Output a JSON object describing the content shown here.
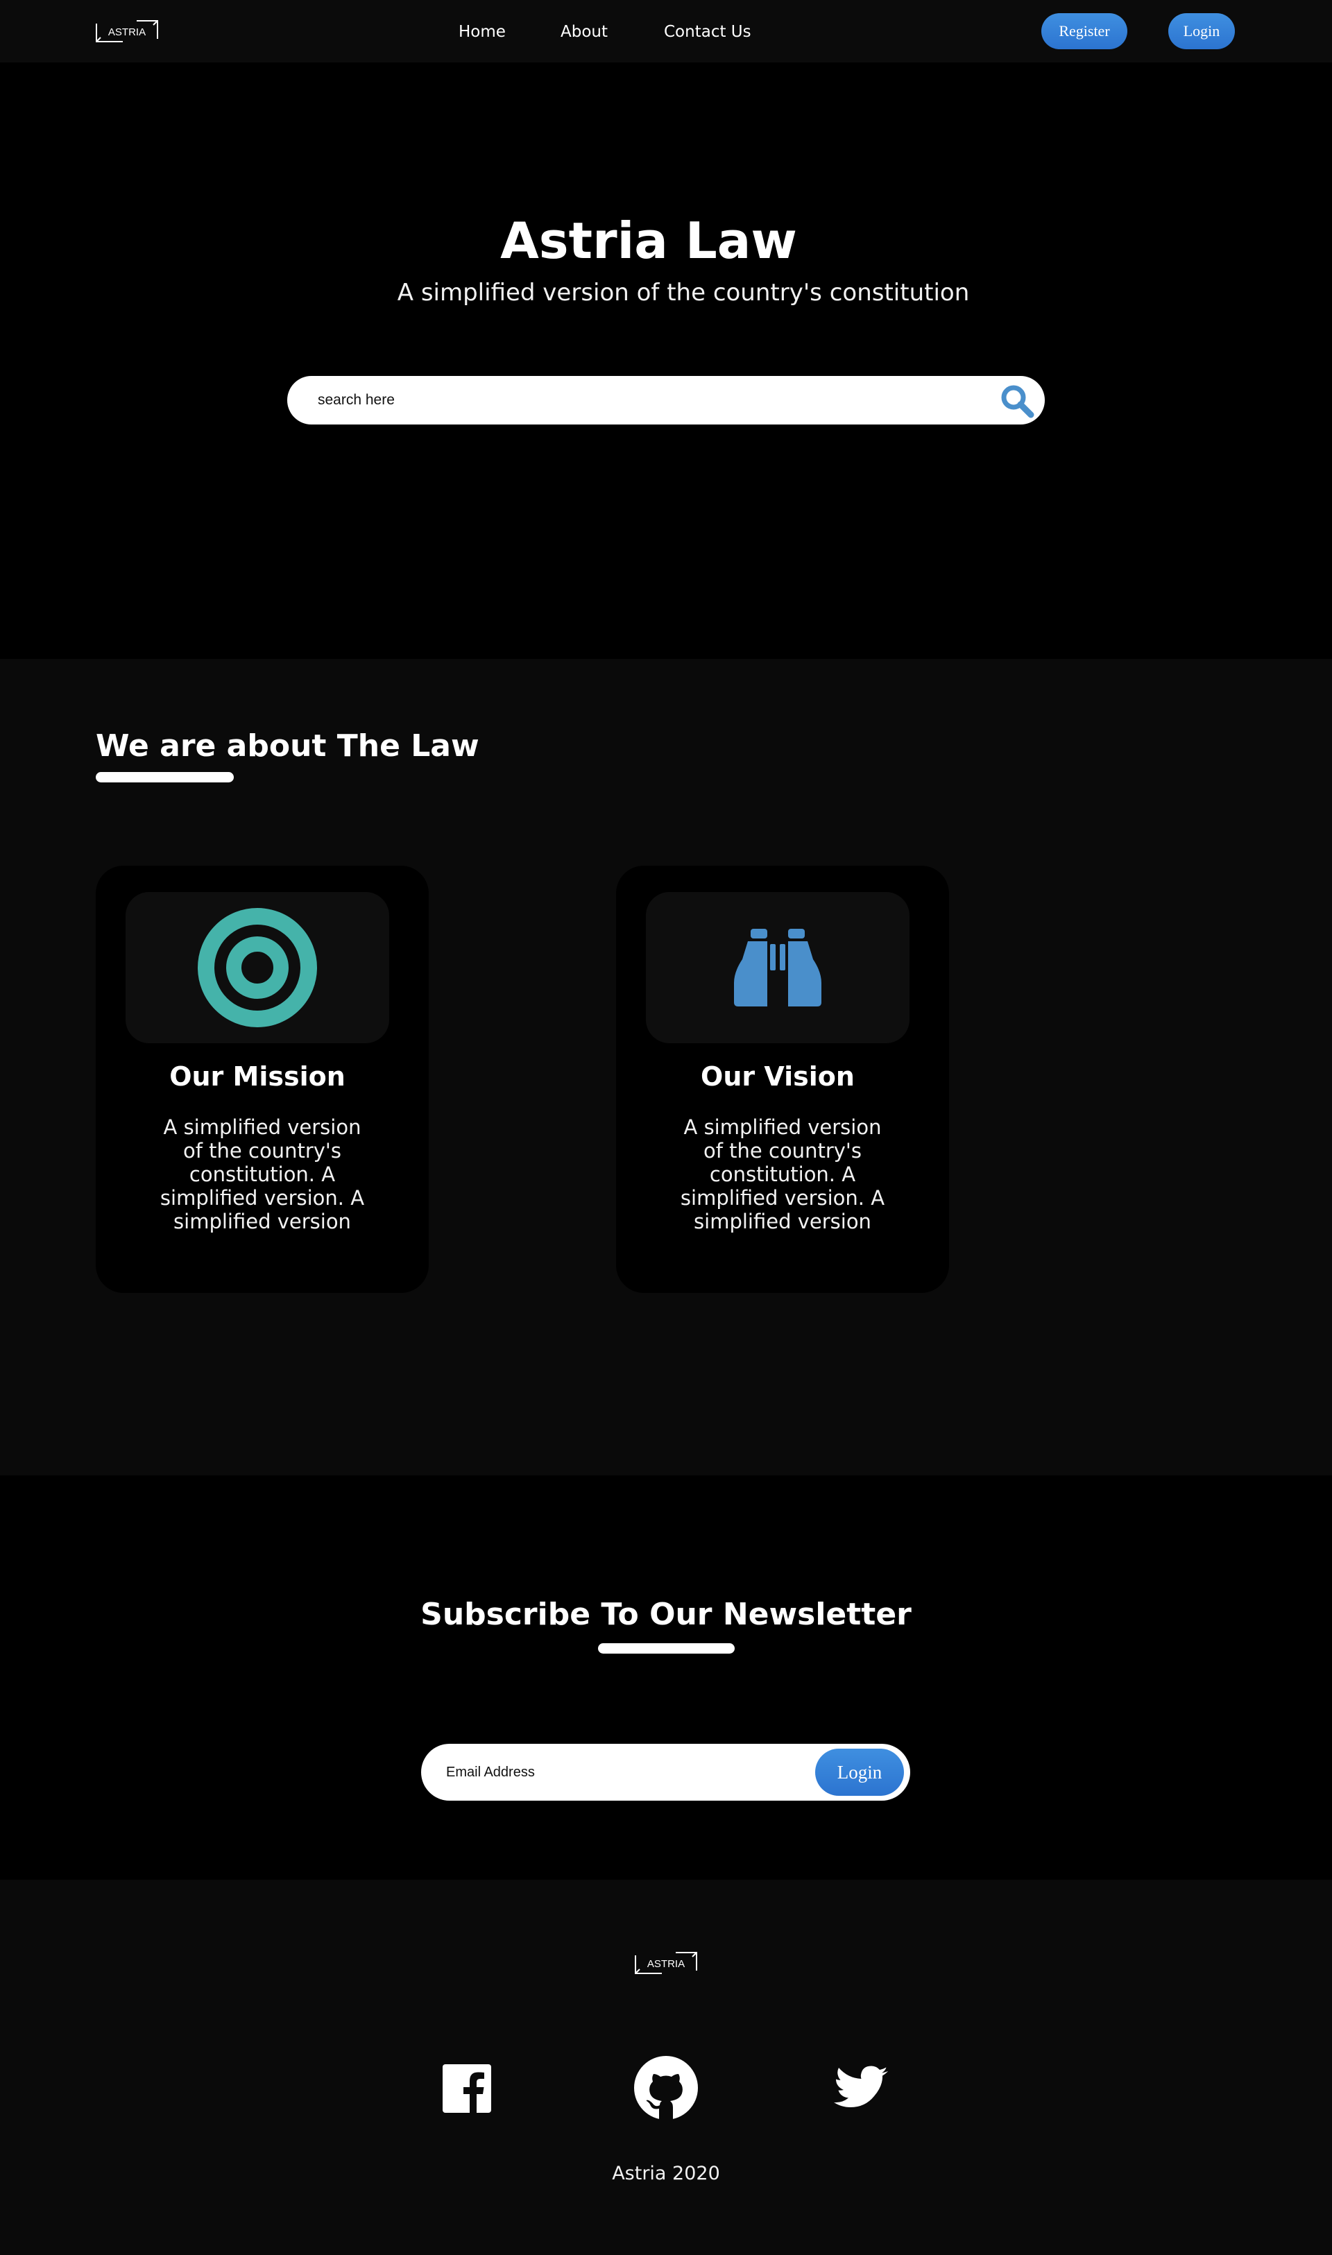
{
  "nav": {
    "logo_text": "ASTRIA",
    "links": [
      "Home",
      "About",
      "Contact Us"
    ],
    "register_label": "Register",
    "login_label": "Login"
  },
  "hero": {
    "title": "Astria Law",
    "subtitle": "A simplified version of the country's constitution",
    "search_placeholder": "search here",
    "search_icon": "search-icon"
  },
  "about": {
    "title": "We are about The Law",
    "cards": [
      {
        "icon": "target-icon",
        "title": "Our Mission",
        "text": "A simplified version of the country's constitution. A simplified version. A simplified version"
      },
      {
        "icon": "binoculars-icon",
        "title": "Our Vision",
        "text": "A simplified version of the country's constitution. A simplified version. A simplified version"
      }
    ]
  },
  "newsletter": {
    "title": "Subscribe To Our Newsletter",
    "email_placeholder": "Email Address",
    "button_label": "Login"
  },
  "footer": {
    "logo_text": "ASTRIA",
    "social": [
      "facebook-icon",
      "github-icon",
      "twitter-icon"
    ],
    "copyright": "Astria 2020"
  },
  "colors": {
    "accent_blue": "#3a85d8",
    "mission_teal": "#45b3aa",
    "vision_blue": "#4a8fcb",
    "background": "#000000",
    "section_dark": "#0a0a0a"
  }
}
